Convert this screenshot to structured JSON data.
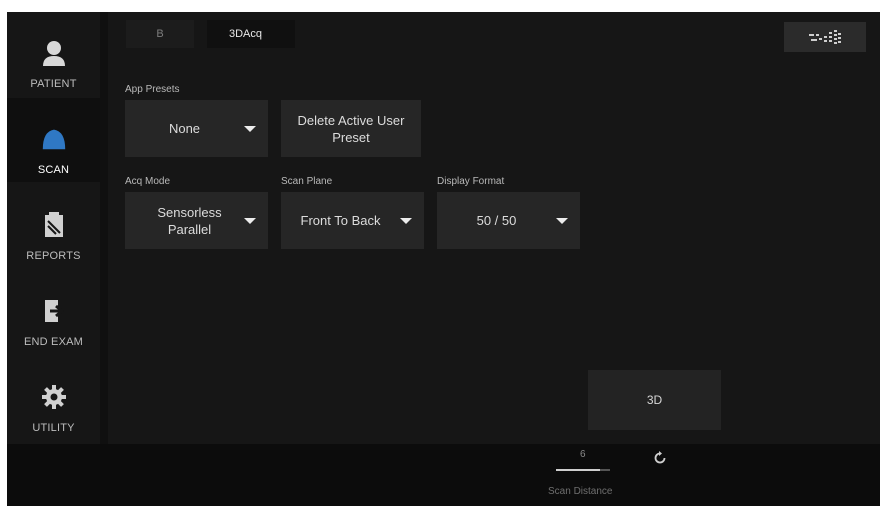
{
  "sidebar": {
    "items": [
      {
        "label": "PATIENT",
        "icon": "person-icon"
      },
      {
        "label": "SCAN",
        "icon": "probe-icon",
        "active": true
      },
      {
        "label": "REPORTS",
        "icon": "report-icon"
      },
      {
        "label": "END EXAM",
        "icon": "exit-icon"
      },
      {
        "label": "UTILITY",
        "icon": "gear-icon"
      }
    ]
  },
  "tabs": [
    {
      "label": "B"
    },
    {
      "label": "3DAcq",
      "active": true
    }
  ],
  "app_presets": {
    "label": "App Presets",
    "value": "None",
    "delete_button": "Delete Active User Preset"
  },
  "acq_mode": {
    "label": "Acq Mode",
    "value": "Sensorless Parallel"
  },
  "scan_plane": {
    "label": "Scan Plane",
    "value": "Front To Back"
  },
  "display_format": {
    "label": "Display Format",
    "value": "50 / 50"
  },
  "action_button": "3D",
  "scan_distance": {
    "value": "6",
    "label": "Scan Distance"
  },
  "colors": {
    "background": "#101010",
    "panel": "#161616",
    "control": "#262626",
    "scan_icon": "#2f78c4"
  }
}
